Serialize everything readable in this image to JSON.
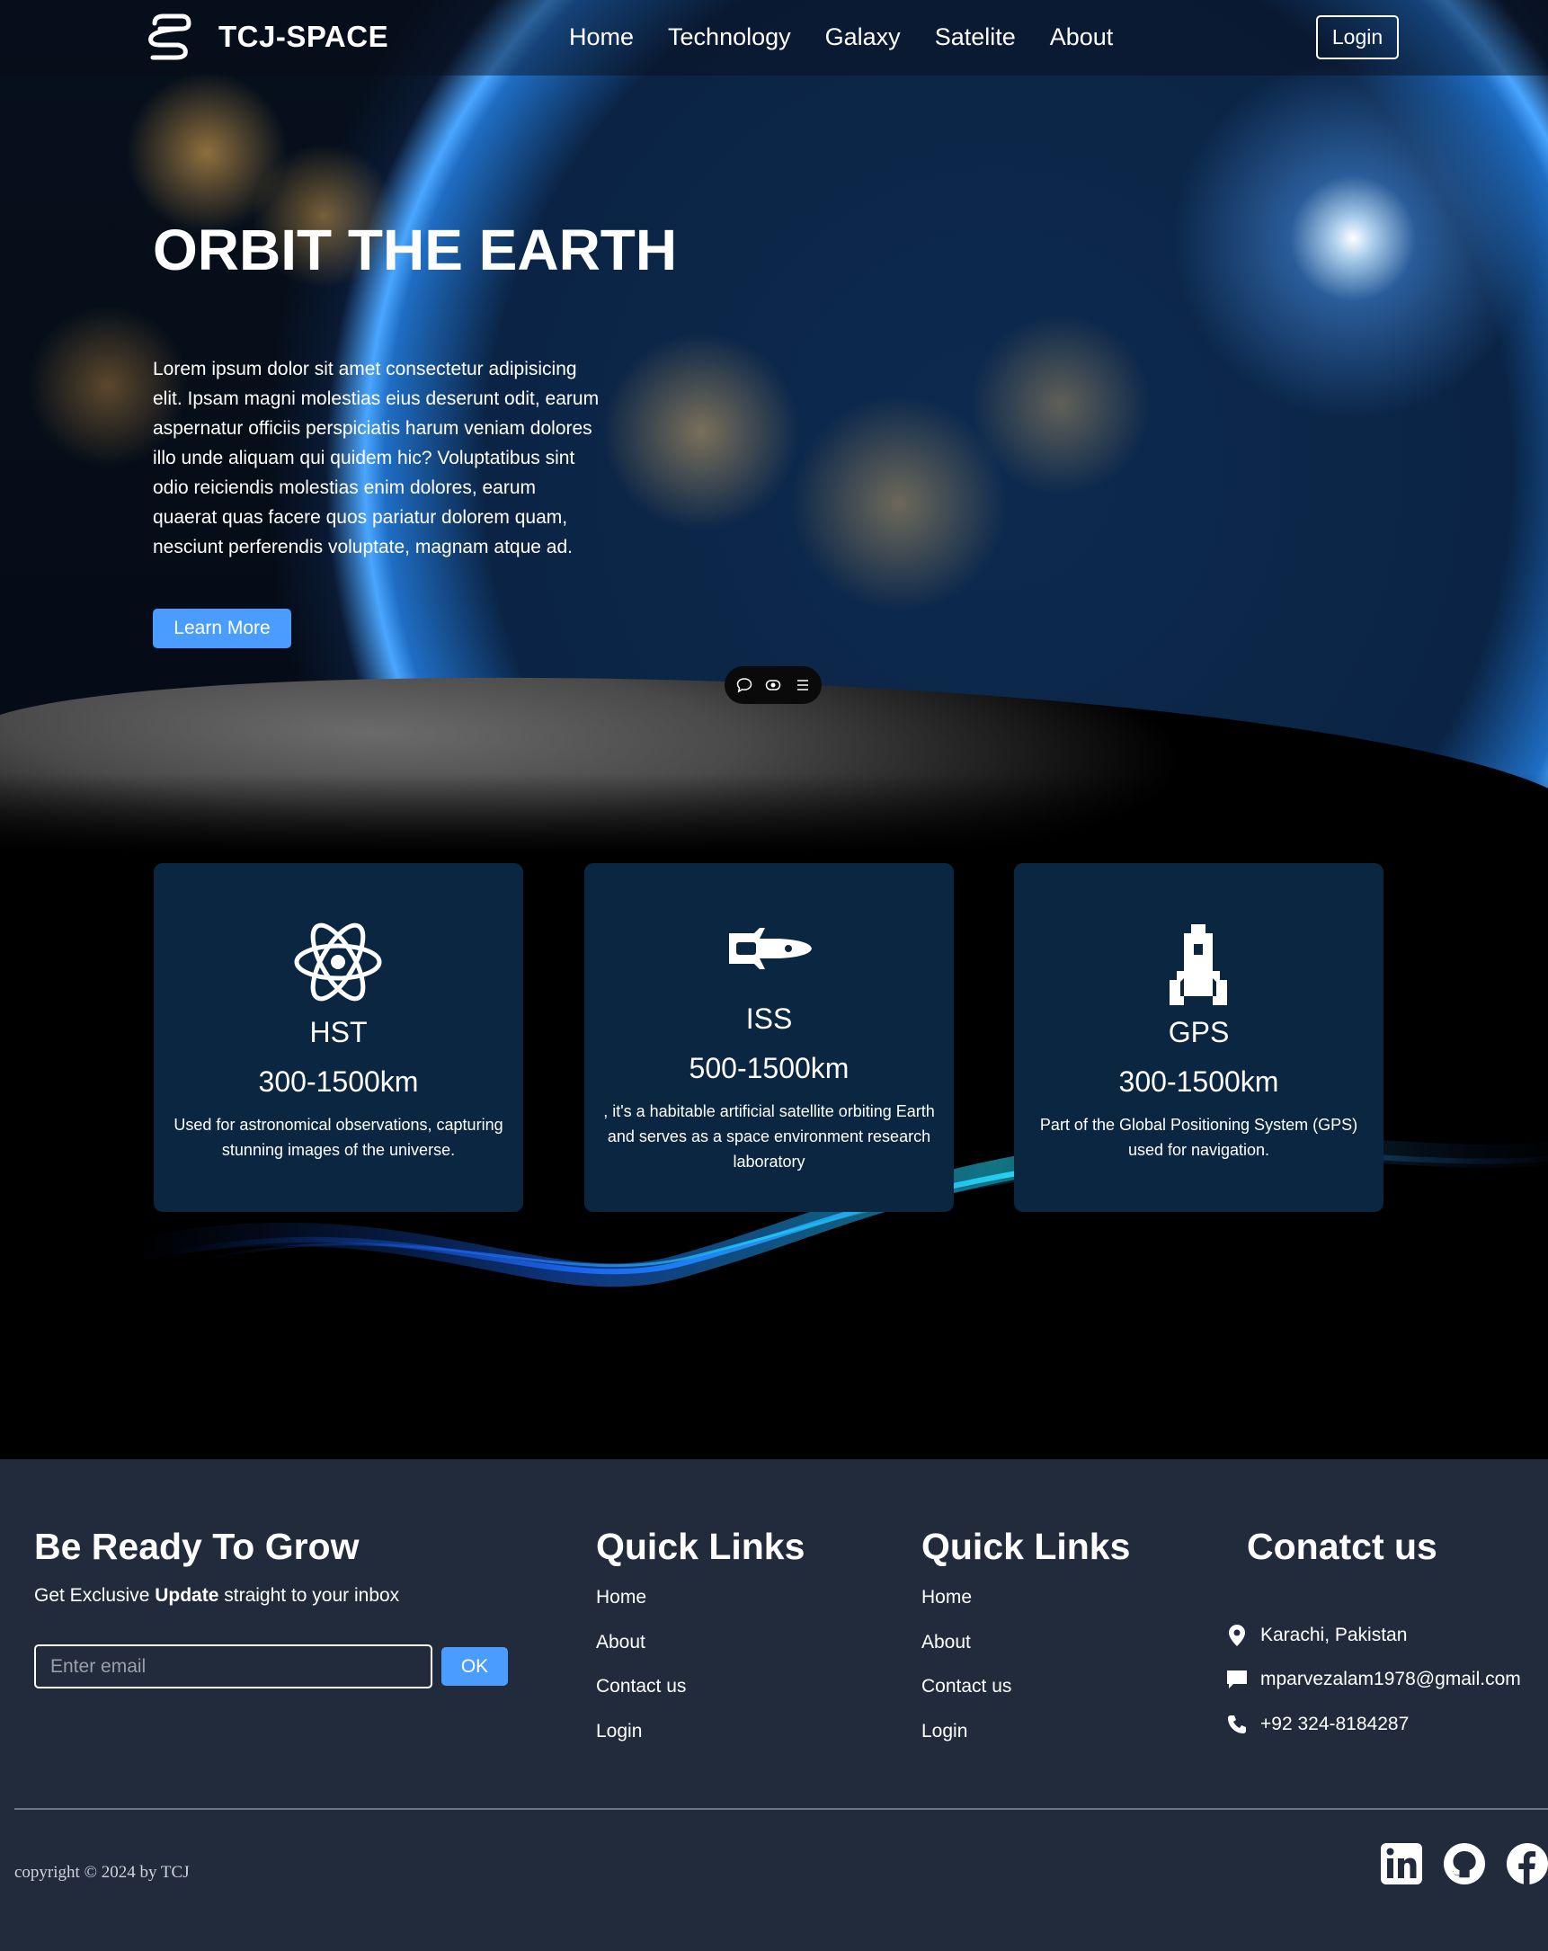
{
  "nav": {
    "brand": "TCJ-SPACE",
    "links": [
      "Home",
      "Technology",
      "Galaxy",
      "Satelite",
      "About"
    ],
    "login_label": "Login"
  },
  "hero": {
    "title": "ORBIT THE EARTH",
    "text": "Lorem ipsum dolor sit amet consectetur adipisicing elit. Ipsam magni molestias eius deserunt odit, earum aspernatur officiis perspiciatis harum veniam dolores illo unde aliquam qui quidem hic? Voluptatibus sint odio reiciendis molestias enim dolores, earum quaerat quas facere quos pariatur dolorem quam, nesciunt perferendis voluptate, magnam atque ad.",
    "button_label": "Learn More",
    "float_bar_icons": [
      "comment-icon",
      "eye-icon",
      "menu-icon"
    ]
  },
  "cards": [
    {
      "icon": "atom-icon",
      "name": "HST",
      "range": "300-1500km",
      "desc": "Used for astronomical observations, capturing stunning images of the universe."
    },
    {
      "icon": "space-shuttle-icon",
      "name": "ISS",
      "range": "500-1500km",
      "desc": ", it's a habitable artificial satellite orbiting Earth and serves as a space environment research laboratory"
    },
    {
      "icon": "rocket-launch-icon",
      "name": "GPS",
      "range": "300-1500km",
      "desc": "Part of the Global Positioning System (GPS) used for navigation."
    }
  ],
  "footer": {
    "grow_title": "Be Ready To Grow",
    "grow_sub_pre": "Get Exclusive ",
    "grow_sub_bold": "Update",
    "grow_sub_post": " straight to your inbox",
    "email_placeholder": "Enter email",
    "ok_label": "OK",
    "quick_links_1_title": "Quick Links",
    "quick_links_1": [
      "Home",
      "About",
      "Contact us",
      "Login"
    ],
    "quick_links_2_title": "Quick Links",
    "quick_links_2": [
      "Home",
      "About",
      "Contact us",
      "Login"
    ],
    "contact_title": "Conatct us",
    "contact": {
      "location": "Karachi, Pakistan",
      "email": "mparvezalam1978@gmail.com",
      "phone": "+92 324-8184287"
    },
    "copyright": "copyright © 2024 by TCJ",
    "social_icons": [
      "linkedin-icon",
      "github-icon",
      "facebook-icon"
    ]
  },
  "colors": {
    "accent": "#4a9dff",
    "card_bg": "#0b2640",
    "footer_bg": "#222b3c"
  }
}
